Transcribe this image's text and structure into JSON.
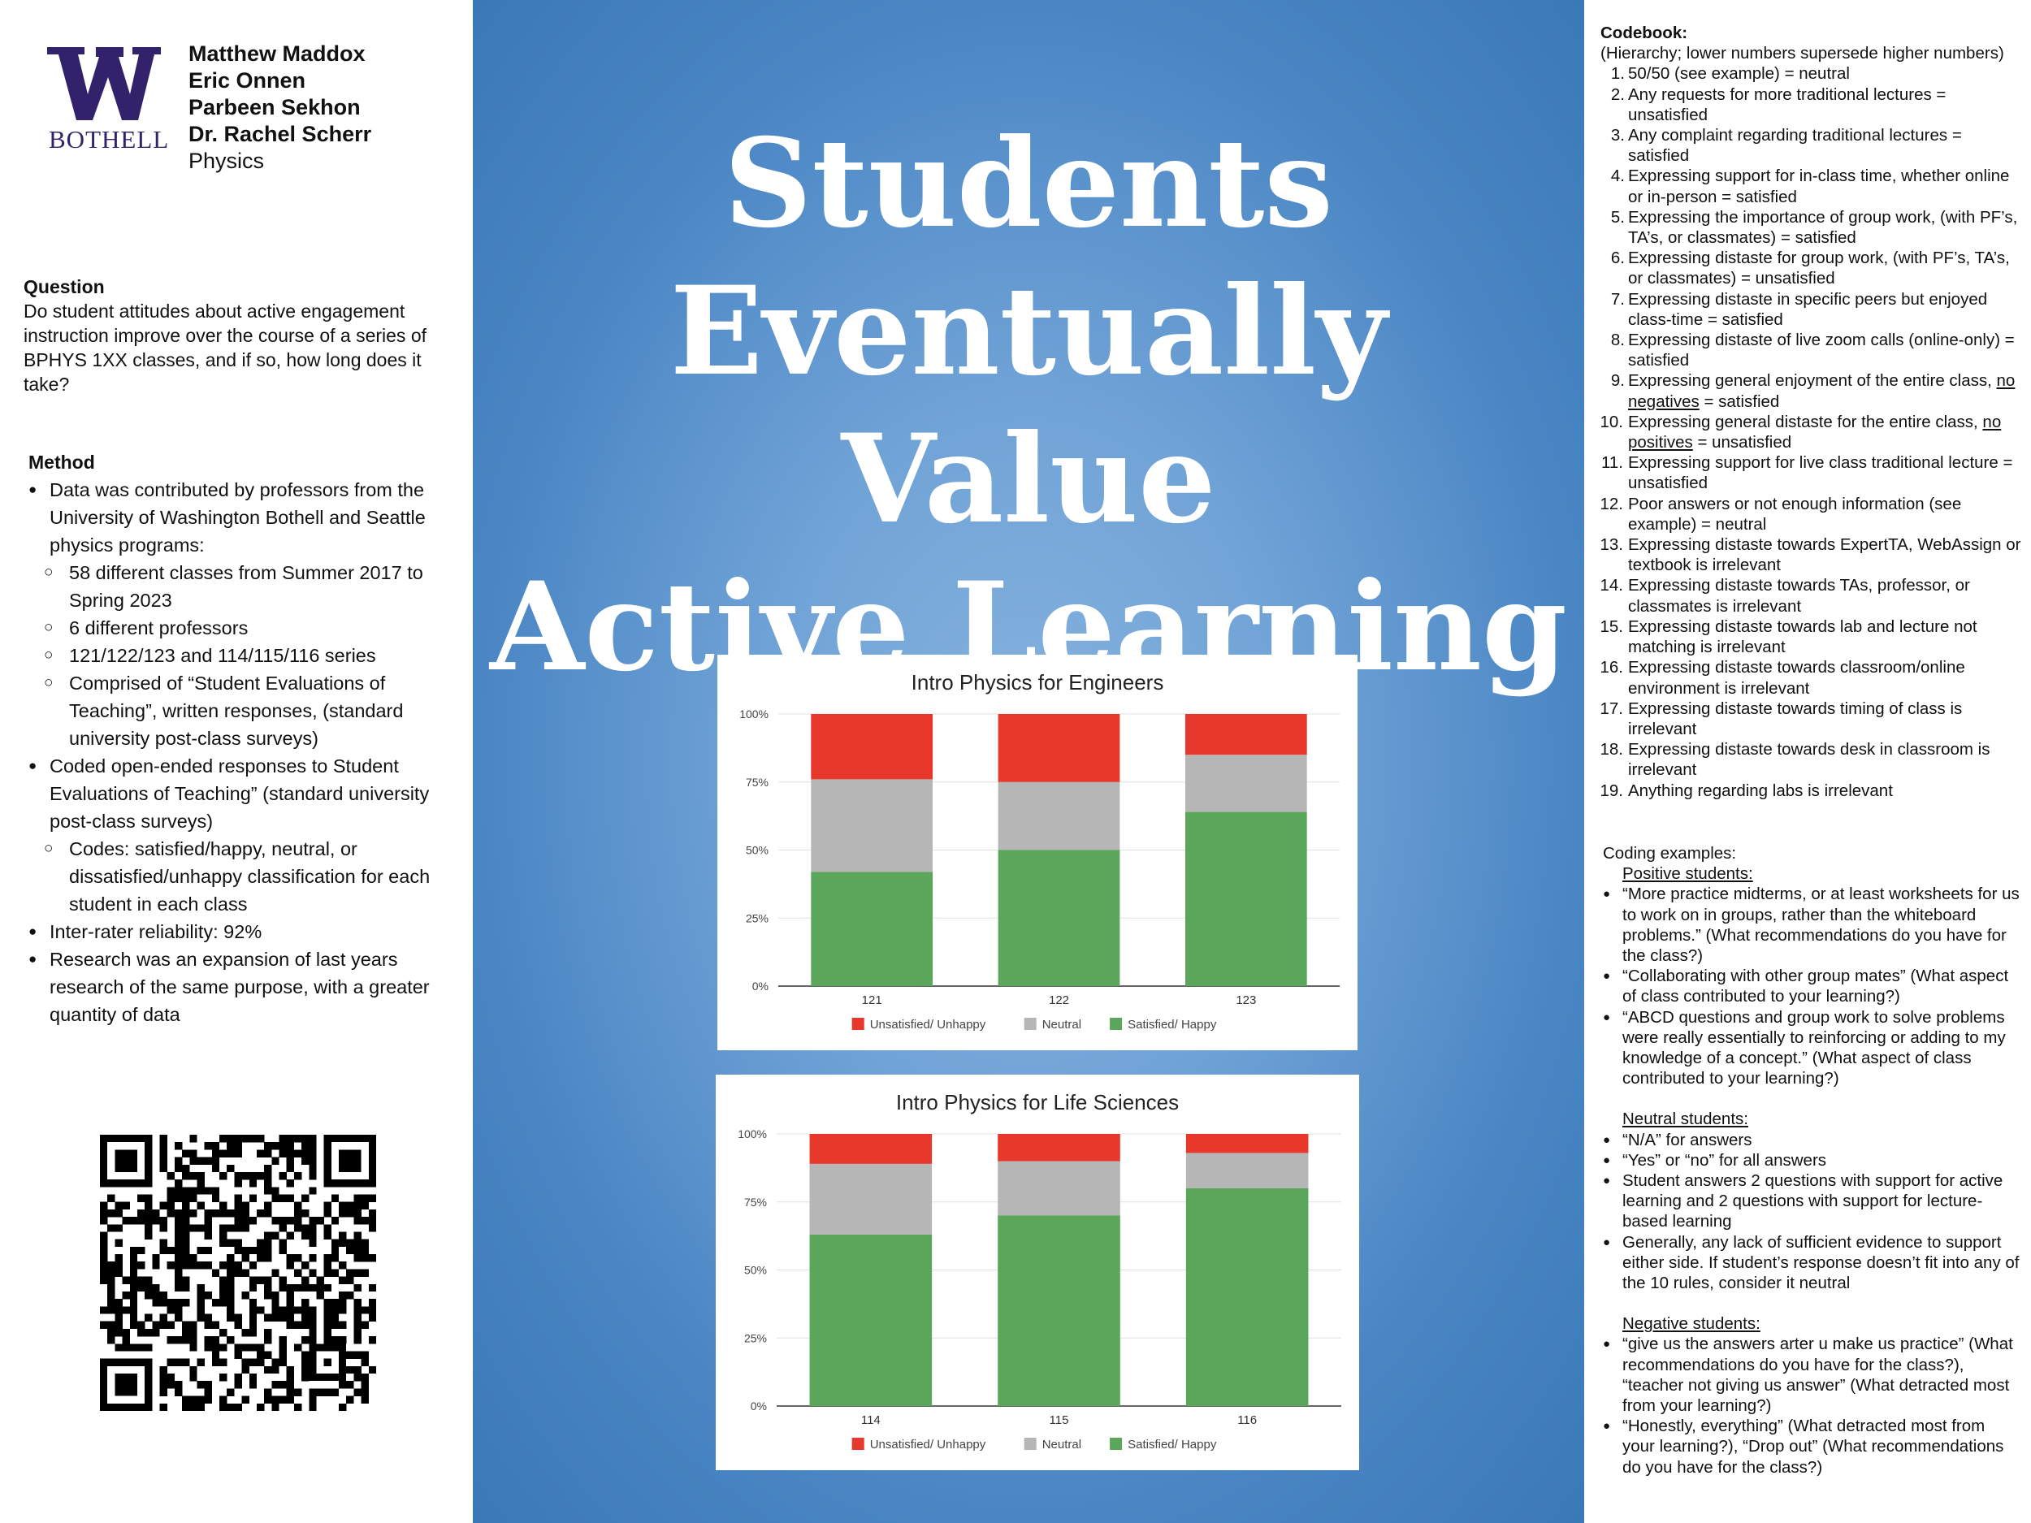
{
  "logo": {
    "text": "BOTHELL",
    "brand_color": "#32226b"
  },
  "authors": {
    "names": [
      "Matthew Maddox",
      "Eric Onnen",
      "Parbeen Sekhon",
      "Dr. Rachel Scherr"
    ],
    "department": "Physics"
  },
  "question": {
    "heading": "Question",
    "text": "Do student attitudes about active engagement instruction improve over the course of a series of BPHYS 1XX classes, and if so, how long does it take?"
  },
  "method": {
    "heading": "Method",
    "items": [
      {
        "level": 1,
        "text": "Data was contributed by professors from the University of Washington Bothell and Seattle physics programs:"
      },
      {
        "level": 2,
        "text": "58 different classes from Summer 2017 to Spring 2023"
      },
      {
        "level": 2,
        "text": "6 different professors"
      },
      {
        "level": 2,
        "text": "121/122/123 and 114/115/116 series"
      },
      {
        "level": 2,
        "text": "Comprised of “Student Evaluations of Teaching”, written responses, (standard university post-class surveys)"
      },
      {
        "level": 1,
        "text": "Coded open-ended responses to Student Evaluations of Teaching” (standard university post-class surveys)"
      },
      {
        "level": 2,
        "text": "Codes: satisfied/happy, neutral, or dissatisfied/unhappy classification for each student in each class"
      },
      {
        "level": 1,
        "text": "Inter-rater reliability: 92%"
      },
      {
        "level": 1,
        "text": "Research was an expansion of last years research of the same purpose, with a greater quantity of data"
      }
    ]
  },
  "qr": {
    "icon": "qr-code"
  },
  "title": {
    "lines": [
      "Students",
      "Eventually Value",
      "Active Learning"
    ]
  },
  "chart_data": [
    {
      "type": "bar",
      "stacked": true,
      "title": "Intro Physics for Engineers",
      "categories": [
        "121",
        "122",
        "123"
      ],
      "ylim": [
        0,
        100
      ],
      "yticks": [
        "0%",
        "25%",
        "50%",
        "75%",
        "100%"
      ],
      "legend_position": "bottom",
      "series": [
        {
          "name": "Unsatisfied/ Unhappy",
          "color": "#e8372b",
          "values": [
            24,
            25,
            15
          ]
        },
        {
          "name": "Neutral",
          "color": "#b6b6b6",
          "values": [
            34,
            25,
            21
          ]
        },
        {
          "name": "Satisfied/ Happy",
          "color": "#5aa65a",
          "values": [
            42,
            50,
            64
          ]
        }
      ]
    },
    {
      "type": "bar",
      "stacked": true,
      "title": "Intro Physics for Life Sciences",
      "categories": [
        "114",
        "115",
        "116"
      ],
      "ylim": [
        0,
        100
      ],
      "yticks": [
        "0%",
        "25%",
        "50%",
        "75%",
        "100%"
      ],
      "legend_position": "bottom",
      "series": [
        {
          "name": "Unsatisfied/ Unhappy",
          "color": "#e8372b",
          "values": [
            11,
            10,
            7
          ]
        },
        {
          "name": "Neutral",
          "color": "#b6b6b6",
          "values": [
            26,
            20,
            13
          ]
        },
        {
          "name": "Satisfied/ Happy",
          "color": "#5aa65a",
          "values": [
            63,
            70,
            80
          ]
        }
      ]
    }
  ],
  "codebook": {
    "heading": "Codebook:",
    "subheading": "(Hierarchy; lower numbers supersede higher numbers)",
    "items": [
      {
        "num": "1.",
        "text": "50/50 (see example) = neutral"
      },
      {
        "num": "2.",
        "text": "Any requests for more traditional lectures = unsatisfied"
      },
      {
        "num": "3.",
        "text": "Any complaint regarding traditional lectures = satisfied"
      },
      {
        "num": "4.",
        "text": "Expressing support for in-class time, whether online or in-person = satisfied"
      },
      {
        "num": "5.",
        "text": "Expressing the importance of group work, (with PF’s, TA’s, or classmates) = satisfied"
      },
      {
        "num": "6.",
        "text": "Expressing distaste for group work, (with PF’s, TA’s, or classmates) = unsatisfied"
      },
      {
        "num": "7.",
        "text": "Expressing distaste in specific peers but enjoyed class-time = satisfied"
      },
      {
        "num": "8.",
        "text": "Expressing distaste of live zoom calls (online-only) = satisfied"
      },
      {
        "num": "9.",
        "pre": "Expressing general enjoyment of the entire class, ",
        "underline": "no negatives",
        "post": " = satisfied"
      },
      {
        "num": "10.",
        "pre": "Expressing general distaste for the entire class, ",
        "underline": "no positives",
        "post": " = unsatisfied"
      },
      {
        "num": "11.",
        "text": "Expressing support for live class traditional lecture = unsatisfied"
      },
      {
        "num": "12.",
        "text": "Poor answers or not enough information (see example) = neutral"
      },
      {
        "num": "13.",
        "text": "Expressing distaste towards ExpertTA, WebAssign or textbook is irrelevant"
      },
      {
        "num": "14.",
        "text": "Expressing distaste towards TAs, professor, or classmates is irrelevant"
      },
      {
        "num": "15.",
        "text": "Expressing distaste towards lab and lecture not matching is irrelevant"
      },
      {
        "num": "16.",
        "text": "Expressing distaste towards classroom/online environment is irrelevant"
      },
      {
        "num": "17.",
        "text": "Expressing distaste towards timing of class is irrelevant"
      },
      {
        "num": "18.",
        "text": "Expressing distaste towards desk in classroom is irrelevant"
      },
      {
        "num": "19.",
        "text": "Anything regarding labs is irrelevant"
      }
    ]
  },
  "examples": {
    "heading": "Coding examples:",
    "groups": [
      {
        "label": "Positive students",
        "items": [
          "“More practice midterms, or at least worksheets for us to work on in groups, rather than the whiteboard problems.” (What recommendations do you have for the class?)",
          "“Collaborating with other group mates” (What aspect of class contributed to your learning?)",
          "“ABCD questions and group work to solve problems were really essentially to reinforcing or adding to my knowledge of a concept.” (What aspect of class contributed to your learning?)"
        ]
      },
      {
        "label": "Neutral students",
        "items": [
          "“N/A” for answers",
          "“Yes” or “no” for all answers",
          "Student answers 2 questions with support for active learning and 2 questions with support for lecture-based learning",
          "Generally, any lack of sufficient evidence to support either side. If student’s response doesn’t fit into any of the 10 rules, consider it neutral"
        ]
      },
      {
        "label": "Negative students",
        "items": [
          "“give us the answers arter u make us practice” (What recommendations do you have for the class?), “teacher not giving us answer” (What detracted most from your learning?)",
          "“Honestly, everything” (What detracted most from your learning?), “Drop out” (What recommendations do you have for the class?)"
        ]
      }
    ]
  }
}
